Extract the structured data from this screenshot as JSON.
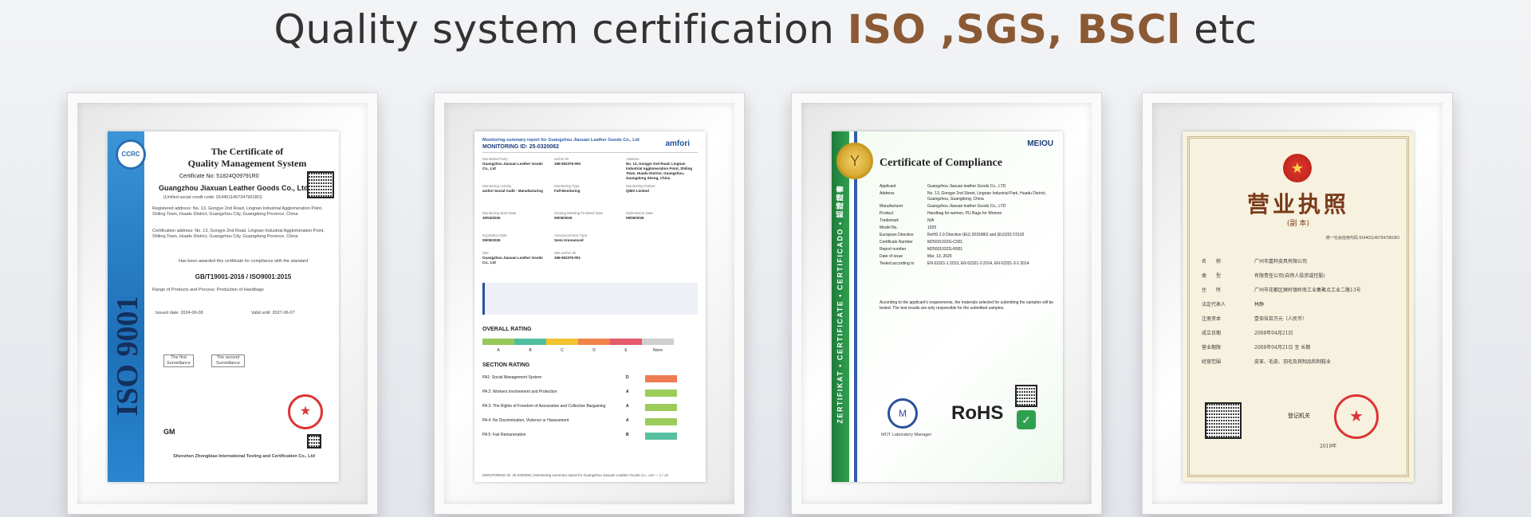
{
  "headline": {
    "prefix": "Quality system certification ",
    "iso": "ISO",
    "sep": " ,",
    "sgs": "SGS",
    "comma": ",",
    "bsci": " BSCl",
    "suffix": " etc"
  },
  "colors": {
    "accent": "#8b5a35",
    "headline_text": "#333333"
  },
  "cert1": {
    "band_text": "ISO 9001",
    "ccrc": "CCRC",
    "title1": "The Certificate of",
    "title2": "Quality Management System",
    "cert_no": "Certificate No: 51824Q09791R0",
    "company": "Guangzhou Jiaxuan Leather Goods Co., Ltd",
    "credit": "(Unified social credit code: 91440114673479618O)",
    "reg": "Registered address: No. 13, Gongye 2nd Road, Lingnan Industrial Agglomeration Point, Shiling Town, Huadu District, Guangzhou City, Guangdong Province, China",
    "cert_addr": "Certification address: No. 13, Gongye 2nd Road, Lingnan Industrial Agglomeration Point, Shiling Town, Huadu District, Guangzhou City, Guangdong Province, China",
    "awarded": "Has been awarded this certificate for compliance with the standard",
    "standard": "GB/T19001-2016 / ISO9001:2015",
    "range": "Range of Products and Process: Production of Handbags",
    "issued": "Issued date: 2024-06-08",
    "valid": "Valid until: 2027-06-07",
    "first": "The first Surveillance",
    "second": "The second Surveillance",
    "gm": "GM",
    "issuer": "Shenzhen Zhongbiao International Testing and Certification Co., Ltd"
  },
  "cert2": {
    "header": "Monitoring summary report for Guangzhou Jiaxuan Leather Goods Co., Ltd",
    "monitoring_id": "MONITORING ID: 25-0320082",
    "brand": "amfori",
    "f1_label": "Monitored Party",
    "f1_value": "Guangzhou Jiaxuan Leather Goods Co., Ltd",
    "f2_label": "amfori ID",
    "f2_value": "156-062375-000",
    "f3_label": "Address",
    "f3_value": "No. 13, Gongye 2nd Road, Lingnan Industrial Agglomeration Point, Shiling Town, Huadu District, Guangzhou, Guangdong Sheng, China",
    "f4_label": "Monitoring Activity",
    "f4_value": "amfori Social Audit - Manufacturing",
    "f5_label": "Monitoring Type",
    "f5_value": "Full Monitoring",
    "f6_label": "Monitoring Partner",
    "f6_value": "QIMA Limited",
    "f7_label": "Monitoring Start Date",
    "f7_value": "30/04/2025",
    "f8_label": "Closing Meeting Finished Date",
    "f8_value": "05/05/2025",
    "f9_label": "Submission Date",
    "f9_value": "05/05/2025",
    "f10_label": "Expiration Date",
    "f10_value": "05/05/2026",
    "f11_label": "Announcement Type",
    "f11_value": "Semi Announced",
    "f12_label": "Site",
    "f12_value": "Guangzhou Jiaxuan Leather Goods Co., Ltd",
    "f13_label": "Site amfori ID",
    "f13_value": "156-062375-001",
    "overall": "OVERALL RATING",
    "grades": [
      "A",
      "B",
      "C",
      "D",
      "E",
      "None"
    ],
    "grade_colors": [
      "#97c95a",
      "#4fbf9d",
      "#f2c230",
      "#f0834a",
      "#e35a6b",
      "#cfcfcf"
    ],
    "section": "SECTION RATING",
    "pa": [
      {
        "label": "PA1: Social Management System",
        "grade": "D",
        "color": "#ef7b52"
      },
      {
        "label": "PA 2: Workers Involvement and Protection",
        "grade": "A",
        "color": "#9ccc5a"
      },
      {
        "label": "PA 3: The Rights of Freedom of Association and Collective Bargaining",
        "grade": "A",
        "color": "#9ccc5a"
      },
      {
        "label": "PA 4: No Discrimination, Violence or Harassment",
        "grade": "A",
        "color": "#9ccc5a"
      },
      {
        "label": "PA 5: Fair Remuneration",
        "grade": "B",
        "color": "#57c1a0"
      }
    ],
    "footer": "MONITORING ID: 25-0320082  |  Monitoring summary report for Guangzhou Jiaxuan Leather Goods Co., Ltd  —  1 / 12"
  },
  "cert3": {
    "brand": "MEIOU",
    "title": "Certificate of Compliance",
    "vertical": "ZERTIFIKAT • CERTIFICATE • CERTIFICADO • 認證證書",
    "rows": [
      [
        "Applicant",
        "Guangzhou Jiaxuan leather Goods Co., LTD"
      ],
      [
        "Address",
        "No. 13, Gongye 2nd Street, Lingnan Industrial Park, Huadu District, Guangzhou, Guangdong, China"
      ],
      [
        "Manufacturer",
        "Guangzhou Jiaxuan leather Goods Co., LTD"
      ],
      [
        "Product",
        "Handbag for women, PU Bags for Women"
      ],
      [
        "Trademark",
        "N/A"
      ],
      [
        "Model No.",
        "1925"
      ],
      [
        "European Directive",
        "RoHS 2.0 Directive (EU) 2015/863 and (EU)2017/2102"
      ],
      [
        "Certificate Number",
        "M2503102ZG-C001"
      ],
      [
        "Report number",
        "M2503102ZG-R001"
      ],
      [
        "Date of issue",
        "Mar. 13, 2025"
      ],
      [
        "Tested according to",
        "EN 62321-1:2013, EN 62321-2:2014, EN 62321-3-1:2014"
      ]
    ],
    "note": "According to the applicant's requirements, the materials selected for submitting the samples will be tested. The test results are only responsible for the submitted samples.",
    "rohs": "RoHS",
    "lab": "MOT Laboratory Manager"
  },
  "cert4": {
    "title": "营业执照",
    "sub": "(副 本)",
    "code": "统一社会信用代码 91440114673479618O",
    "rows": [
      [
        "名　　称",
        "广州市嘉轩皮具有限公司"
      ],
      [
        "类　　型",
        "有限责任公司(自然人投资或控股)"
      ],
      [
        "住　　所",
        "广州市花都区狮岭镇岭南工业集聚点工业二路13号"
      ],
      [
        "法定代表人",
        "林静"
      ],
      [
        "注册资本",
        "壹佰伍拾万元（人民币）"
      ],
      [
        "成立日期",
        "2008年04月21日"
      ],
      [
        "营业期限",
        "2008年04月21日 至 长期"
      ],
      [
        "经营范围",
        "皮革、毛皮、羽毛及其制品和制鞋业"
      ]
    ],
    "authority": "登记机关",
    "date": "2019年"
  }
}
